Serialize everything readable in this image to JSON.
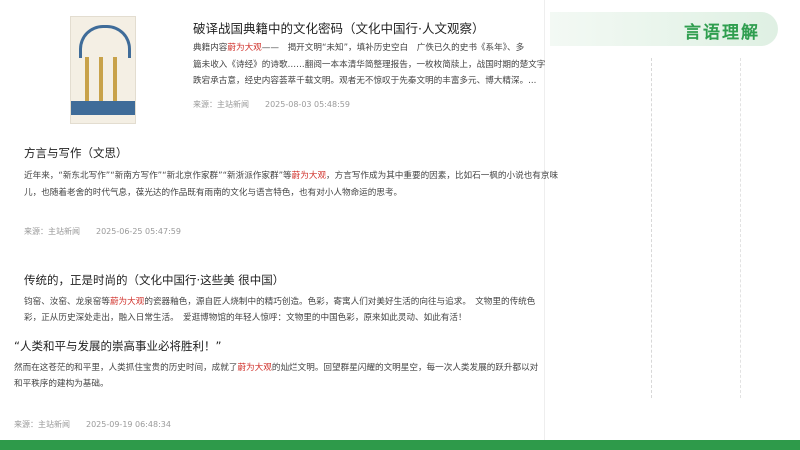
{
  "header": {
    "title": "言语理解"
  },
  "articles": [
    {
      "title": "破译战国典籍中的文化密码（文化中国行·人文观察）",
      "line1_a": "典籍内容",
      "line1_hl": "蔚为大观",
      "line1_b": "——　揭开文明“未知”，填补历史空白　广佚已久的史书《系年》、多",
      "line2": "篇未收入《诗经》的诗歌……翻阅一本本清华简整理报告，一枚枚简牍上，战国时期的楚文字",
      "line3": "跌宕承古意，经史内容荟萃千载文明。观者无不惊叹于先秦文明的丰富多元、博大精深。...",
      "source": "来源：主站新闻",
      "date": "2025-08-03 05:48:59"
    },
    {
      "title": "方言与写作（文思）",
      "line1_a": "近年来，“新东北写作”“新南方写作”“新北京作家群”“新浙派作家群”等",
      "line1_hl": "蔚为大观",
      "line1_b": "，方言写作成为其中重要的因素，比如石一枫的小说也有京味",
      "line2": "儿，也随着老舍的时代气息，葆光达的作品既有雨南的文化与语言特色，也有对小人物命运的思考。",
      "source": "来源：主站新闻",
      "date": "2025-06-25 05:47:59"
    },
    {
      "title": "传统的，正是时尚的（文化中国行·这些美 很中国）",
      "line1_a": "钧窑、汝窑、龙泉窑等",
      "line1_hl": "蔚为大观",
      "line1_b": "的瓷器釉色，源自匠人烧制中的精巧创造。色彩，寄寓人们对美好生活的向往与追求。　文物里的传统色",
      "line2": "彩，正从历史深处走出，融入日常生活。　爱逛博物馆的年轻人惊呼：文物里的中国色彩，原来如此灵动、如此有活！"
    },
    {
      "title": "“人类和平与发展的崇高事业必将胜利！”",
      "line1_a": "然而在这苍茫的和平里，人类抓住宝贵的历史时间，成就了",
      "line1_hl": "蔚为大观",
      "line1_b": "的灿烂文明。回望群星闪耀的文明星空，每一次人类发展的跃升都以对",
      "line2": "和平秩序的建构为基础。",
      "source": "来源：主站新闻",
      "date": "2025-09-19 06:48:34"
    }
  ]
}
